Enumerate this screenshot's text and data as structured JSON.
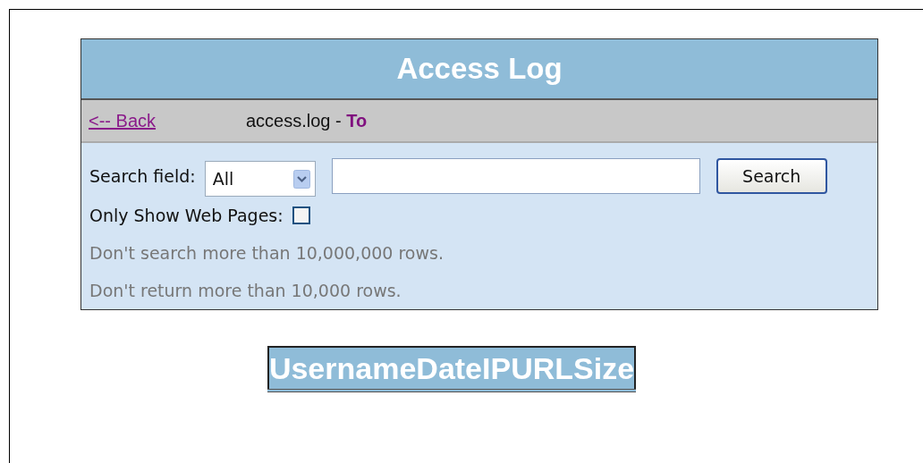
{
  "title": "Access Log",
  "nav": {
    "back_link": "<-- Back",
    "file": "access.log - ",
    "file_suffix": "To"
  },
  "search": {
    "label": "Search field:",
    "field_select": "All",
    "button": "Search"
  },
  "web_pages_only": {
    "label": "Only Show Web Pages:",
    "checked": false
  },
  "notes": [
    "Don't search more than 10,000,000 rows.",
    "Don't return more than 10,000 rows."
  ],
  "table": {
    "columns": [
      "Username",
      "Date",
      "IP",
      "URL",
      "Size"
    ]
  }
}
